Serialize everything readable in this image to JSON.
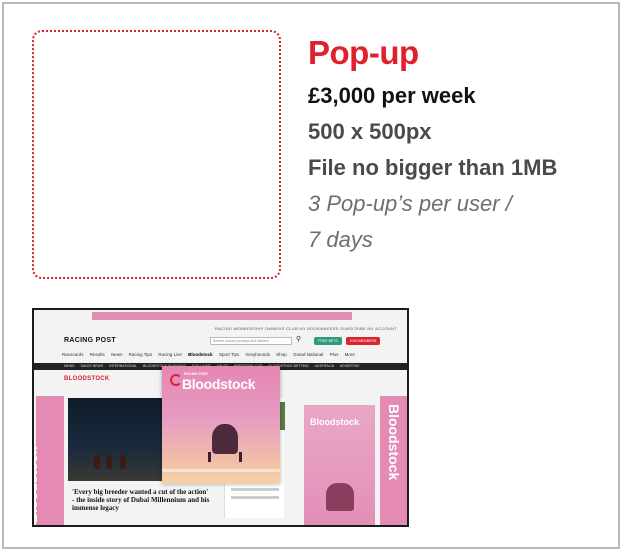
{
  "product": {
    "title": "Pop-up",
    "price": "£3,000 per week",
    "size": "500 x 500px",
    "file_limit": "File no bigger than 1MB",
    "frequency_line1": "3 Pop-up’s per user /",
    "frequency_line2": "7 days"
  },
  "colors": {
    "accent": "#e0202b",
    "placeholder_border": "#d9232d",
    "card_border": "#b8b8b8"
  },
  "screenshot": {
    "logo": "RACING POST",
    "utility_links": "RACING MEMBERSHIP  OWNERS CLUB  MY BOOKMAKERS  SUBSCRIBE  MY ACCOUNT",
    "search_placeholder": "Search horses, jockeys and trainers",
    "join_button": "FREE BETS",
    "subscribe_button": "JOIN MEMBERS",
    "nav": [
      "Racecards",
      "Results",
      "News",
      "Racing Tips",
      "Racing Live",
      "Bloodstock",
      "Sport Tips",
      "Greyhounds",
      "Shop",
      "Grand National",
      "Plus",
      "More"
    ],
    "active_nav": "Bloodstock",
    "subnav": [
      "NEWS",
      "SALES NEWS",
      "INTERNATIONAL",
      "BLOODSTOCK BUSINESS",
      "STALLIONS",
      "SALES",
      "BREEDERS' CUP",
      "BLOODSTOCK BETTING",
      "AUSTRALIA",
      "ADVERTISE"
    ],
    "section_title": "BLOODSTOCK",
    "headline": "'Every big breeder wanted a cut of the action' - the inside story of Dubai Millennium and his immense legacy",
    "popup_kicker": "RACING POST",
    "popup_brand": "Bloodstock",
    "banner_text": "Bloodstock",
    "ad_label": "Bloodstock"
  }
}
